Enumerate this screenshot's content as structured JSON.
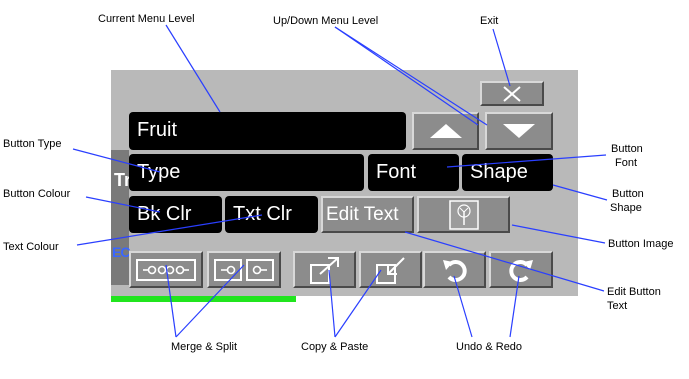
{
  "toolbar": {
    "menu_level_label": "Fruit",
    "type_label": "Type",
    "font_label": "Font",
    "shape_label": "Shape",
    "bk_clr_label": "Bk Clr",
    "txt_clr_label": "Txt Clr",
    "edit_text_label": "Edit Text",
    "strip_letters": "Tr",
    "strip_letters_2": "EC"
  },
  "icons": {
    "exit": "close-icon",
    "up": "triangle-up-icon",
    "down": "triangle-down-icon",
    "image": "tree-image-icon",
    "merge": "merge-icon",
    "split": "split-icon",
    "copy": "copy-icon",
    "paste": "paste-icon",
    "undo": "undo-icon",
    "redo": "redo-icon"
  },
  "colors": {
    "panel": "#b9b9b9",
    "button_black": "#000000",
    "button_grey": "#8c8c8c",
    "accent_green": "#21e51e",
    "strip_blue": "#3a66ff",
    "leader_line": "#2a3fff"
  },
  "annotations": {
    "current_menu_level": "Current Menu Level",
    "up_down_menu_level": "Up/Down Menu Level",
    "exit": "Exit",
    "button_type": "Button Type",
    "button_colour": "Button Colour",
    "text_colour": "Text Colour",
    "button_font_1": "Button",
    "button_font_2": "Font",
    "button_shape_1": "Button",
    "button_shape_2": "Shape",
    "button_image": "Button Image",
    "edit_button_text_1": "Edit Button",
    "edit_button_text_2": "Text",
    "merge_split": "Merge & Split",
    "copy_paste": "Copy & Paste",
    "undo_redo": "Undo & Redo"
  }
}
